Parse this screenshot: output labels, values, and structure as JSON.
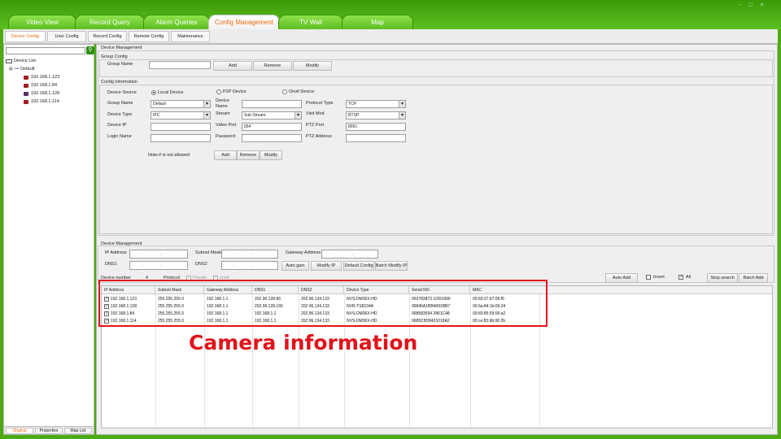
{
  "window": {
    "controls": "- □ ×",
    "accent_color": "#4cab10",
    "active_tab_color": "#e46a12"
  },
  "main_tabs": [
    {
      "label": "Video View"
    },
    {
      "label": "Record Query"
    },
    {
      "label": "Alarm Queries"
    },
    {
      "label": "Config Management",
      "active": true
    },
    {
      "label": "TV Wall"
    },
    {
      "label": "Map"
    }
  ],
  "sub_tabs": [
    {
      "label": "Device Config",
      "active": true
    },
    {
      "label": "User Config"
    },
    {
      "label": "Record Config"
    },
    {
      "label": "Remote Config"
    },
    {
      "label": "Maintenance"
    }
  ],
  "sidebar": {
    "search_value": "",
    "search_icon": "search-icon",
    "root_label": "Device List",
    "group_label": "Default",
    "devices": [
      "192.168.1.123",
      "192.168.1.84",
      "192.168.1.128",
      "192.168.1.114"
    ],
    "bottom_tabs": [
      {
        "label": "Original",
        "active": true
      },
      {
        "label": "Properties"
      },
      {
        "label": "Map List"
      }
    ]
  },
  "device_management_top": {
    "title": "Device Management",
    "group_config": {
      "title": "Group Config",
      "group_name_label": "Group Name",
      "group_name_value": "",
      "add": "Add",
      "remove": "Remove",
      "modify": "Modify"
    },
    "config_info": {
      "title": "Config Information",
      "device_source_label": "Device Source",
      "sources": [
        "Local Device",
        "P2P Device",
        "Onvif Device"
      ],
      "selected_source": "Local Device",
      "group_name_label": "Group Name",
      "group_name_value": "Default",
      "device_name_label": "Device Name",
      "device_name_value": "",
      "protocol_type_label": "Protocol Type",
      "protocol_type_value": "TCP",
      "device_type_label": "Device Type",
      "device_type_value": "IPC",
      "stream_label": "Stream",
      "stream_value": "Sub Stream",
      "visit_mod_label": "Visit Mod",
      "visit_mod_value": "RTSP",
      "device_ip_label": "Device IP",
      "device_ip_value": "",
      "video_port_label": "Video Port",
      "video_port_value": "554",
      "ptz_port_label": "PTZ Port",
      "ptz_port_value": "8091",
      "login_name_label": "Login Name",
      "login_name_value": "",
      "password_label": "Password",
      "password_value": "",
      "ptz_address_label": "PTZ Address",
      "ptz_address_value": "",
      "note": "Note:# is not allowed",
      "add": "Add",
      "remove": "Remove",
      "modify": "Modify"
    }
  },
  "device_management_bottom": {
    "title": "Device Management",
    "ip_address_label": "IP Address",
    "subnet_mask_label": "Subnet Mask",
    "gateway_label": "Gateway Address",
    "dns1_label": "DNS1",
    "dns2_label": "DNS2",
    "ip_dots": ". . .",
    "auto_gain": "Auto gain",
    "modify_ip": "Modify IP",
    "default_config": "Default Config",
    "batch_modify_ip": "Batch Modify IP",
    "device_number_label": "Device number",
    "device_number_value": "4",
    "protocol_label": "Protocol",
    "protocol_opt1": "Private",
    "protocol_opt2": "onvif",
    "auto_add": "Auto Add",
    "invert": "Invert",
    "all": "All",
    "stop_search": "Stop search",
    "batch_add": "Batch Add"
  },
  "table": {
    "columns": [
      "IP Address",
      "Subnet Mask",
      "Gateway Address",
      "DNS1",
      "DNS2",
      "Device Type",
      "Serial NO.",
      "MAC"
    ],
    "rows": [
      [
        "192.168.1.123",
        "255.255.255.0",
        "192.168.1.1",
        "202.96.128.86",
        "202.96.134.133",
        "NVS-DM36X-HD",
        "063783873 1DD1890",
        "00:83:37:b7:06:f5"
      ],
      [
        "192.168.1.128",
        "255.255.255.0",
        "192.168.1.1",
        "202.96.128.166",
        "202.96.134.133",
        "NVR-TS8104A",
        "06846A1BB4091BB7",
        "00:6a:84:1b:06:24"
      ],
      [
        "192.168.1.84",
        "255.255.255.0",
        "192.168.1.1",
        "192.168.1.1",
        "202.96.134.133",
        "NVS-DM36X-HD",
        "068583594 2861C48",
        "00:83:85:59:06:a2"
      ],
      [
        "192.168.1.114",
        "255.255.255.0",
        "192.168.1.1",
        "192.168.1.1",
        "202.96.134.133",
        "NVS-DM36X-HD",
        "0685C8D8431018A2",
        "00:ce:83:db:06:2b"
      ]
    ]
  },
  "annotation": {
    "text": "Camera information",
    "color": "#e0141a"
  }
}
